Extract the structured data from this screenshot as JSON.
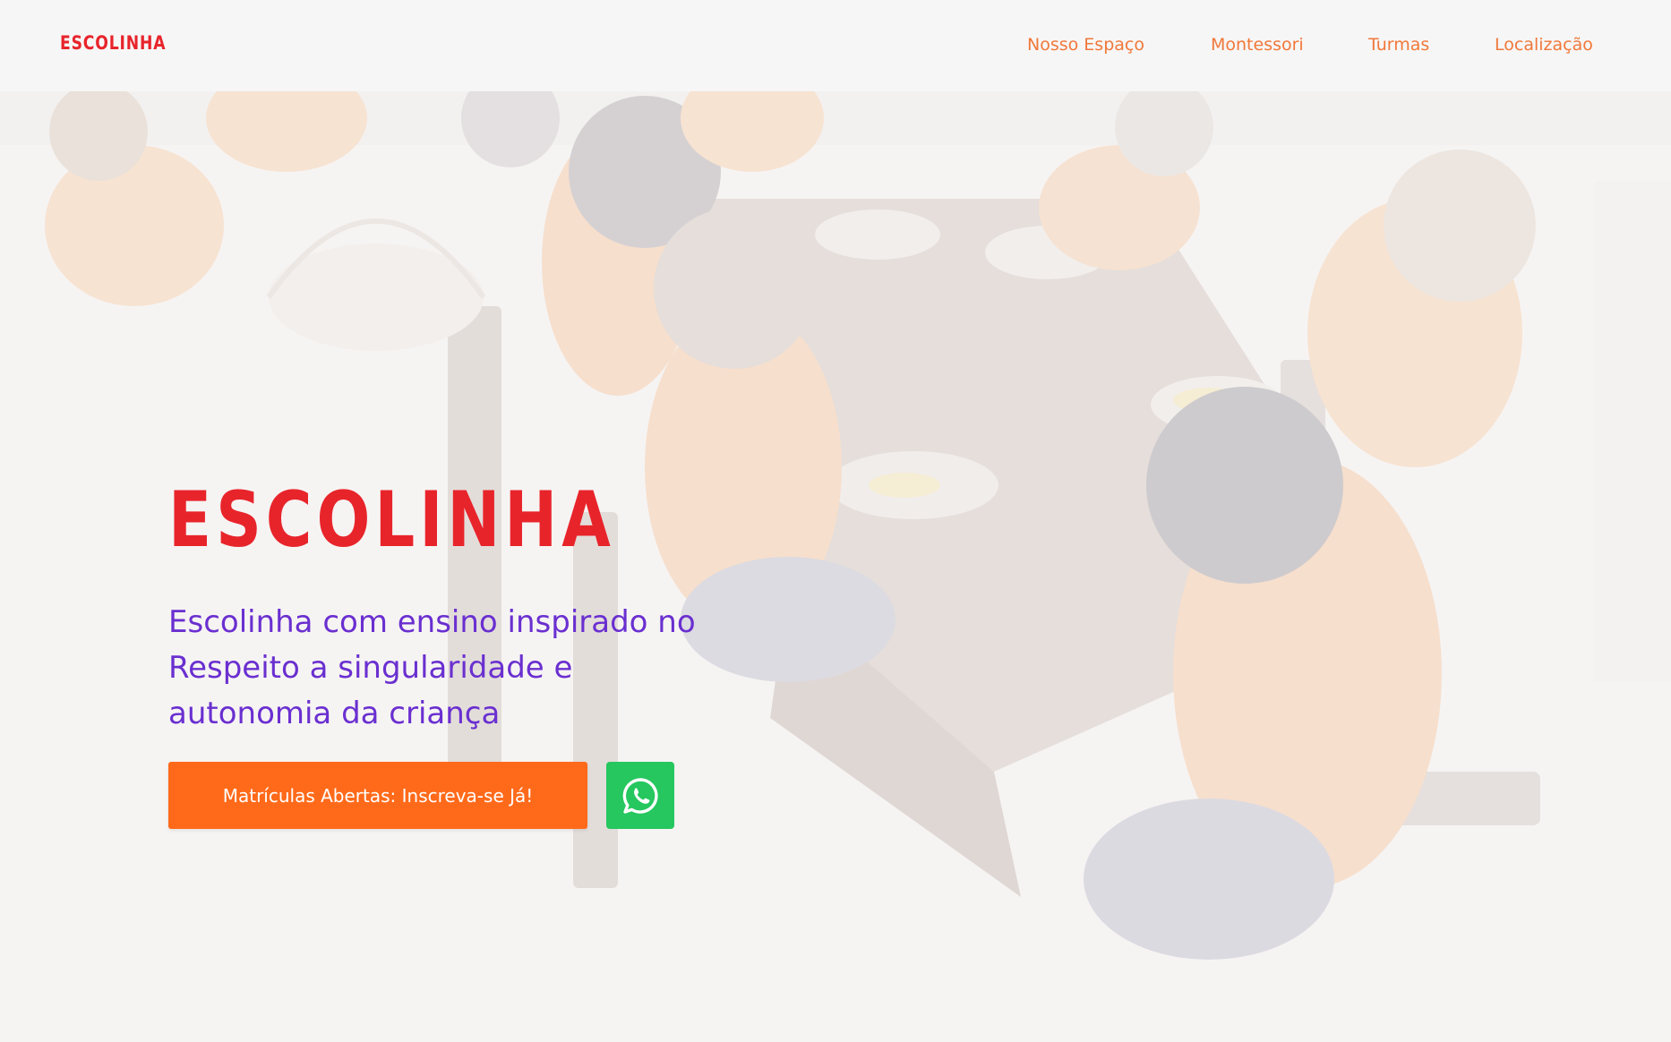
{
  "header": {
    "logo": "ESCOLINHA",
    "nav": [
      "Nosso Espaço",
      "Montessori",
      "Turmas",
      "Localização"
    ]
  },
  "hero": {
    "title": "ESCOLINHA",
    "subtitle": "Escolinha com ensino inspirado no Respeito a singularidade e autonomia da criança",
    "cta_label": "Matrículas Abertas: Inscreva-se Já!",
    "whatsapp_icon": "whatsapp-icon"
  },
  "colors": {
    "brand_red": "#e8242b",
    "nav_orange": "#f0783a",
    "subtitle_purple": "#6a2fd0",
    "cta_orange": "#ff6a1a",
    "whatsapp_green": "#25c75e"
  }
}
